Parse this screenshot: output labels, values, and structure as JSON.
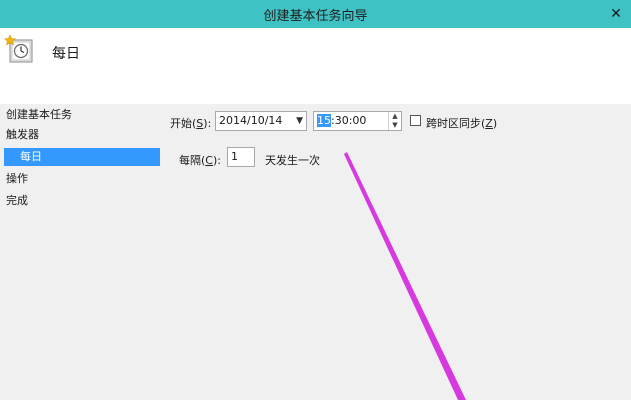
{
  "window": {
    "title": "创建基本任务向导",
    "close_glyph": "✕"
  },
  "header": {
    "title": "每日"
  },
  "nav": {
    "items": [
      {
        "label": "创建基本任务"
      },
      {
        "label": "触发器"
      },
      {
        "label": "每日"
      },
      {
        "label": "操作"
      },
      {
        "label": "完成"
      }
    ]
  },
  "form": {
    "start_label": "开始(",
    "start_hotkey": "S",
    "start_label_end": "):",
    "date_value": "2014/10/14",
    "time_selected": "15",
    "time_rest": ":30:00",
    "sync_label": "跨时区同步(",
    "sync_hotkey": "Z",
    "sync_label_end": ")",
    "recur_label": "每隔(",
    "recur_hotkey": "C",
    "recur_label_end": "):",
    "recur_value": "1",
    "recur_suffix": "天发生一次"
  },
  "colors": {
    "titlebar": "#3fc2c3",
    "selection": "#3399ff",
    "annotation": "#d63adf"
  }
}
